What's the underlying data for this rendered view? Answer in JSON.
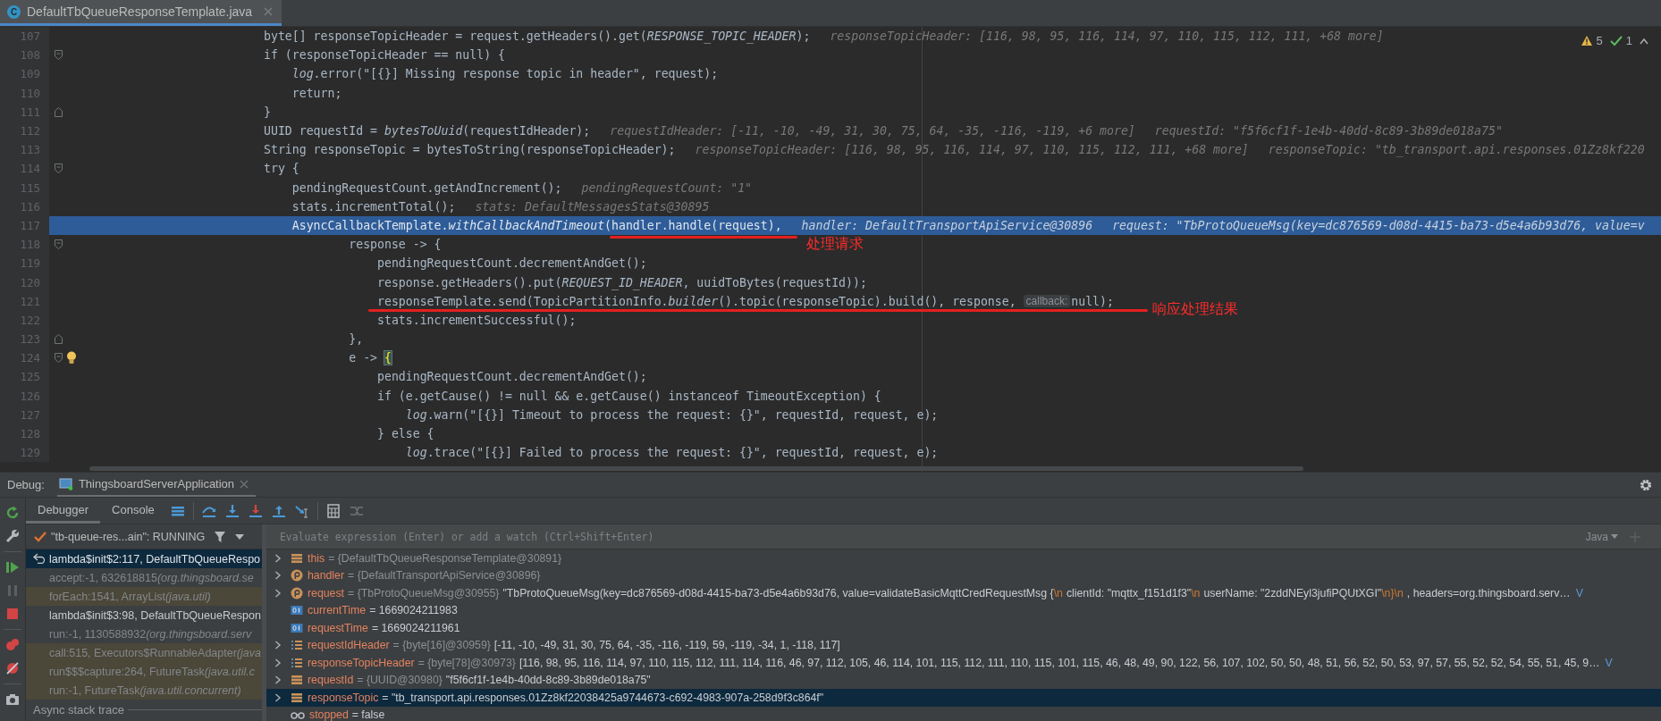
{
  "editor_tab": {
    "badge": "C",
    "title": "DefaultTbQueueResponseTemplate.java",
    "selected": true
  },
  "inspections": {
    "warnings": "5",
    "weak_warnings": "1"
  },
  "code_lines": [
    {
      "number": "107",
      "highlighted": false,
      "kind": "plain",
      "bulb": false,
      "code": "byte[] responseTopicHeader = request.getHeaders().get(*RESPONSE_TOPIC_HEADER*);",
      "hints": [
        "responseTopicHeader: [116, 98, 95, 116, 114, 97, 110, 115, 112, 111, +68 more]"
      ]
    },
    {
      "number": "108",
      "highlighted": false,
      "kind": "opener",
      "bulb": false,
      "code": "if (responseTopicHeader == null) {"
    },
    {
      "number": "109",
      "highlighted": false,
      "kind": "plain",
      "bulb": false,
      "code": "    *log*.error(\"[{}] Missing response topic in header\", request);"
    },
    {
      "number": "110",
      "highlighted": false,
      "kind": "plain",
      "bulb": false,
      "code": "    return;"
    },
    {
      "number": "111",
      "highlighted": false,
      "kind": "closer",
      "bulb": false,
      "code": "}"
    },
    {
      "number": "112",
      "highlighted": false,
      "kind": "plain",
      "bulb": false,
      "code": "UUID requestId = *bytesToUuid*(requestIdHeader);",
      "hints": [
        "requestIdHeader: [-11, -10, -49, 31, 30, 75, 64, -35, -116, -119, +6 more]",
        "requestId: \"f5f6cf1f-1e4b-40dd-8c89-3b89de018a75\""
      ]
    },
    {
      "number": "113",
      "highlighted": false,
      "kind": "plain",
      "bulb": false,
      "code": "String responseTopic = bytesToString(responseTopicHeader);",
      "hints": [
        "responseTopicHeader: [116, 98, 95, 116, 114, 97, 110, 115, 112, 111, +68 more]",
        "responseTopic: \"tb_transport.api.responses.01Zz8kf220"
      ]
    },
    {
      "number": "114",
      "highlighted": false,
      "kind": "opener",
      "bulb": false,
      "code": "try {"
    },
    {
      "number": "115",
      "highlighted": false,
      "kind": "plain",
      "bulb": false,
      "code": "    pendingRequestCount.getAndIncrement();",
      "hints": [
        "pendingRequestCount: \"1\""
      ]
    },
    {
      "number": "116",
      "highlighted": false,
      "kind": "plain",
      "bulb": false,
      "code": "    stats.incrementTotal();",
      "hints": [
        "stats: DefaultMessagesStats@30895"
      ]
    },
    {
      "number": "117",
      "highlighted": true,
      "kind": "plain",
      "bulb": false,
      "code": "    AsyncCallbackTemplate.*withCallbackAndTimeout*(handler.handle(request),",
      "hints": [
        "handler: DefaultTransportApiService@30896",
        "request: \"TbProtoQueueMsg(key=dc876569-d08d-4415-ba73-d5e4a6b93d76, value=v"
      ]
    },
    {
      "number": "118",
      "highlighted": false,
      "kind": "opener",
      "bulb": false,
      "code": "            response -> {"
    },
    {
      "number": "119",
      "highlighted": false,
      "kind": "plain",
      "bulb": false,
      "code": "                pendingRequestCount.decrementAndGet();"
    },
    {
      "number": "120",
      "highlighted": false,
      "kind": "plain",
      "bulb": false,
      "code": "                response.getHeaders().put(*REQUEST_ID_HEADER*, uuidToBytes(requestId));"
    },
    {
      "number": "121",
      "highlighted": false,
      "kind": "plain",
      "bulb": false,
      "code": "                responseTemplate.send(TopicPartitionInfo.*builder*().topic(responseTopic).build(), response,",
      "param_hint": "callback:",
      "code_after": "null);"
    },
    {
      "number": "122",
      "highlighted": false,
      "kind": "plain",
      "bulb": false,
      "code": "                stats.incrementSuccessful();"
    },
    {
      "number": "123",
      "highlighted": false,
      "kind": "closer",
      "bulb": false,
      "code": "            },"
    },
    {
      "number": "124",
      "highlighted": false,
      "kind": "opener",
      "bulb": true,
      "code": "            e ->",
      "brace": "{"
    },
    {
      "number": "125",
      "highlighted": false,
      "kind": "plain",
      "bulb": false,
      "code": "                pendingRequestCount.decrementAndGet();"
    },
    {
      "number": "126",
      "highlighted": false,
      "kind": "plain",
      "bulb": false,
      "code": "                if (e.getCause() != null && e.getCause() instanceof TimeoutException) {"
    },
    {
      "number": "127",
      "highlighted": false,
      "kind": "plain",
      "bulb": false,
      "code": "                    *log*.warn(\"[{}] Timeout to process the request: {}\", requestId, request, e);"
    },
    {
      "number": "128",
      "highlighted": false,
      "kind": "plain",
      "bulb": false,
      "code": "                } else {"
    },
    {
      "number": "129",
      "highlighted": false,
      "kind": "plain",
      "bulb": false,
      "code": "                    *log*.trace(\"[{}] Failed to process the request: {}\", requestId, request, e);"
    }
  ],
  "annotations": [
    {
      "text": "处理请求"
    },
    {
      "text": "响应处理结果"
    }
  ],
  "debug": {
    "label": "Debug:",
    "session_tab": "ThingsboardServerApplication",
    "tabs": [
      {
        "label": "Debugger",
        "selected": true
      },
      {
        "label": "Console",
        "selected": false
      }
    ],
    "thread": "\"tb-queue-res...ain\": RUNNING",
    "frames": [
      {
        "method": "lambda$init$2:117, DefaultTbQueueRespo",
        "kind": "project",
        "selected": true
      },
      {
        "method": "accept:-1, 632618815",
        "location": "(org.thingsboard.se",
        "kind": "generated",
        "selected": false
      },
      {
        "method": "forEach:1541, ArrayList",
        "location": "(java.util)",
        "kind": "library",
        "selected": false
      },
      {
        "method": "lambda$init$3:98, DefaultTbQueueRespon",
        "kind": "project",
        "selected": false
      },
      {
        "method": "run:-1, 1130588932",
        "location": "(org.thingsboard.serv",
        "kind": "generated",
        "selected": false
      },
      {
        "method": "call:515, Executors$RunnableAdapter",
        "location": "(java",
        "kind": "library",
        "selected": false
      },
      {
        "method": "run$$$capture:264, FutureTask",
        "location": "(java.util.c",
        "kind": "library",
        "selected": false
      },
      {
        "method": "run:-1, FutureTask",
        "location": "(java.util.concurrent)",
        "kind": "library",
        "selected": false
      }
    ],
    "async_label": "Async stack trace",
    "evaluate": {
      "placeholder": "Evaluate expression (Enter) or add a watch (Ctrl+Shift+Enter)",
      "language": "Java"
    },
    "variables": [
      {
        "expandable": true,
        "kind": "field",
        "name": "this",
        "type": "= {DefaultTbQueueResponseTemplate@30891}",
        "selected": false
      },
      {
        "expandable": true,
        "kind": "param",
        "name": "handler",
        "type": "= {DefaultTransportApiService@30896}",
        "selected": false
      },
      {
        "expandable": true,
        "kind": "param",
        "name": "request",
        "type": "= {TbProtoQueueMsg@30955}",
        "value": [
          {
            "kind": "plain",
            "t": "\"TbProtoQueueMsg(key=dc876569-d08d-4415-ba73-d5e4a6b93d76, value=validateBasicMqttCredRequestMsg {"
          },
          {
            "kind": "escape",
            "t": "\\n"
          },
          {
            "kind": "plain",
            "t": "clientId: \"mqttx_f151d1f3\""
          },
          {
            "kind": "escape",
            "t": "\\n"
          },
          {
            "kind": "plain",
            "t": "userName: \"2zddNEyl3jufiPQUtXGI\""
          },
          {
            "kind": "escape",
            "t": "\\n}\\n"
          },
          {
            "kind": "plain",
            "t": ", headers=org.thingsboard.serv…"
          }
        ],
        "link": "V",
        "selected": false
      },
      {
        "expandable": false,
        "kind": "primitive",
        "name": "currentTime",
        "value": [
          {
            "kind": "plain",
            "t": "= 1669024211983"
          }
        ],
        "selected": false
      },
      {
        "expandable": false,
        "kind": "primitive",
        "name": "requestTime",
        "value": [
          {
            "kind": "plain",
            "t": "= 1669024211961"
          }
        ],
        "selected": false
      },
      {
        "expandable": true,
        "kind": "array",
        "name": "requestIdHeader",
        "type": "= {byte[16]@30959}",
        "value": [
          {
            "kind": "plain",
            "t": "[-11, -10, -49, 31, 30, 75, 64, -35, -116, -119, 59, -119, -34, 1, -118, 117]"
          }
        ],
        "selected": false
      },
      {
        "expandable": true,
        "kind": "array",
        "name": "responseTopicHeader",
        "type": "= {byte[78]@30973}",
        "value": [
          {
            "kind": "plain",
            "t": "[116, 98, 95, 116, 114, 97, 110, 115, 112, 111, 114, 116, 46, 97, 112, 105, 46, 114, 101, 115, 112, 111, 110, 115, 101, 115, 46, 48, 49, 90, 122, 56, 107, 102, 50, 50, 48, 51, 56, 52, 50, 53, 97, 57, 55, 52, 52, 54, 55, 51, 45, 9…"
          }
        ],
        "link": "V",
        "selected": false
      },
      {
        "expandable": true,
        "kind": "field",
        "name": "requestId",
        "type": "= {UUID@30980}",
        "value": [
          {
            "kind": "plain",
            "t": "\"f5f6cf1f-1e4b-40dd-8c89-3b89de018a75\""
          }
        ],
        "selected": false
      },
      {
        "expandable": true,
        "kind": "field",
        "name": "responseTopic",
        "value": [
          {
            "kind": "plain",
            "t": "= \"tb_transport.api.responses.01Zz8kf22038425a9744673-c692-4983-907a-258d9f3c864f\""
          }
        ],
        "selected": true
      },
      {
        "expandable": false,
        "kind": "watch",
        "name": "stopped",
        "value": [
          {
            "kind": "plain",
            "t": "= false"
          }
        ],
        "selected": false
      }
    ]
  }
}
